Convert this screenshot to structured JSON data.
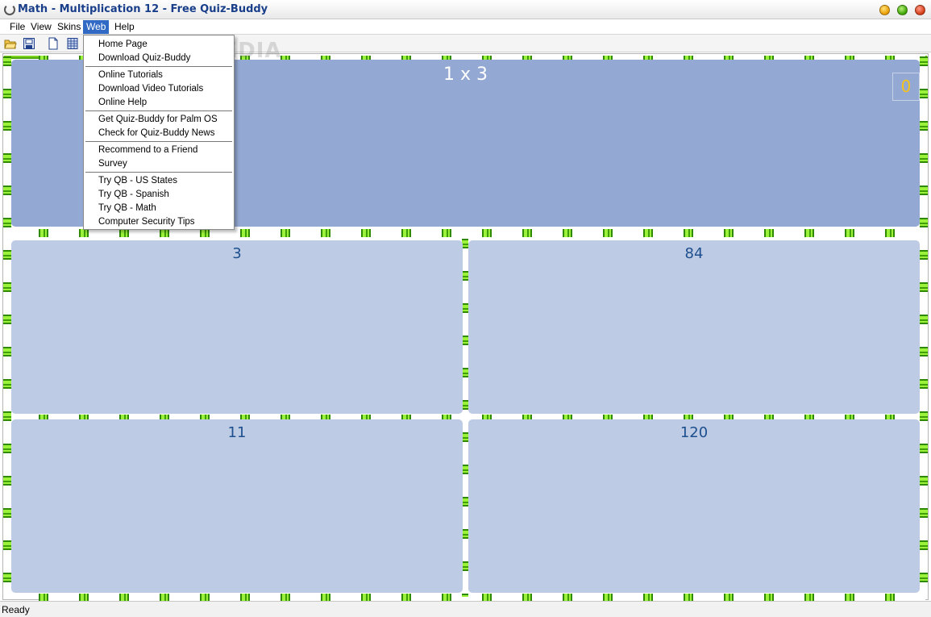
{
  "window": {
    "title": "Math - Multiplication 12 - Free Quiz-Buddy"
  },
  "menubar": {
    "items": [
      {
        "label": "File"
      },
      {
        "label": "View"
      },
      {
        "label": "Skins"
      },
      {
        "label": "Web"
      },
      {
        "label": "Help"
      }
    ],
    "active": "Web"
  },
  "toolbar": {
    "icons": [
      "open-folder-icon",
      "save-icon",
      "new-document-icon",
      "grid-icon"
    ]
  },
  "web_menu": {
    "items": [
      "Home Page",
      "Download Quiz-Buddy",
      "Online Tutorials",
      "Download Video Tutorials",
      "Online Help",
      "Get Quiz-Buddy for Palm OS",
      "Check for Quiz-Buddy News",
      "Recommend to a Friend",
      "Survey",
      "Try QB - US States",
      "Try QB - Spanish",
      "Try QB - Math",
      "Computer Security Tips"
    ]
  },
  "quiz": {
    "question": "1 x 3",
    "score": "0",
    "answers": [
      "3",
      "84",
      "11",
      "120"
    ]
  },
  "watermark": "SOFTPEDIA",
  "status": {
    "text": "Ready"
  },
  "colors": {
    "question_panel": "#93a8d3",
    "answer_panel": "#bdcbe4",
    "bamboo": "#7fd41f",
    "title_text": "#1a3f8a",
    "score": "#f4c21a"
  }
}
